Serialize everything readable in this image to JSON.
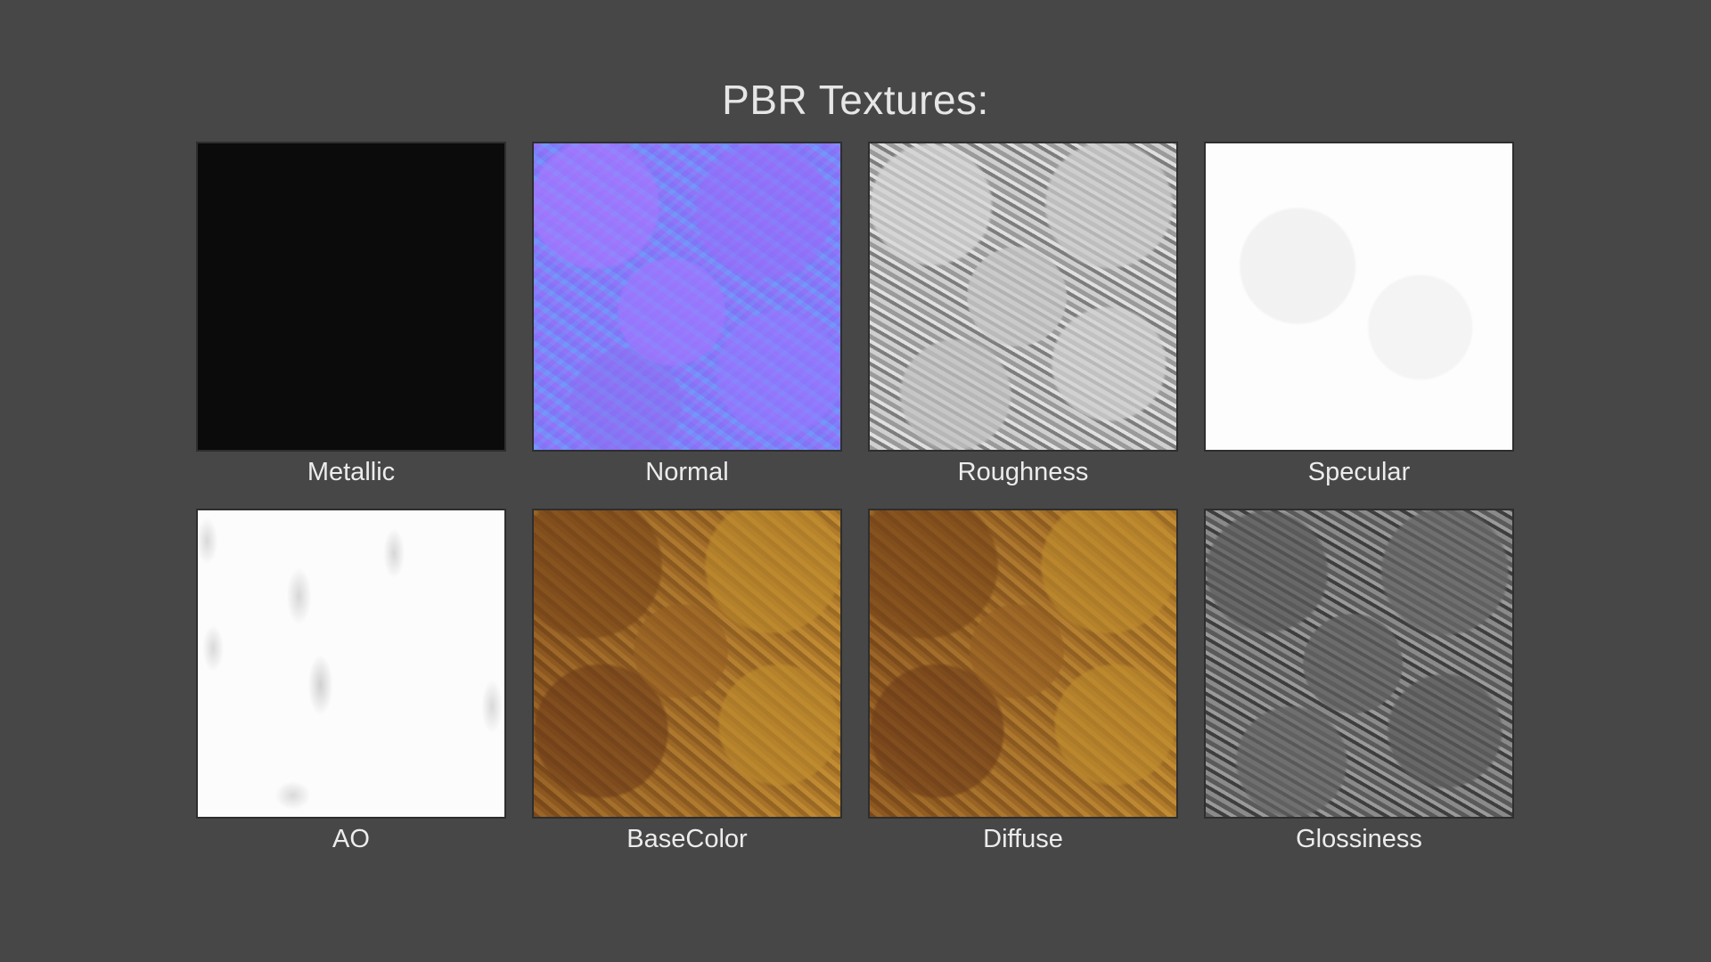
{
  "title": "PBR Textures:",
  "textures": [
    {
      "label": "Metallic",
      "color": "#0b0b0b"
    },
    {
      "label": "Normal",
      "color": "#8278f4"
    },
    {
      "label": "Roughness",
      "color": "#a9a9a9"
    },
    {
      "label": "Specular",
      "color": "#fdfdfd"
    },
    {
      "label": "AO",
      "color": "#fcfcfc"
    },
    {
      "label": "BaseColor",
      "color": "#a6702a"
    },
    {
      "label": "Diffuse",
      "color": "#a6702a"
    },
    {
      "label": "Glossiness",
      "color": "#6a6a6a"
    }
  ],
  "colors": {
    "background": "#474747",
    "text": "#ececec"
  }
}
